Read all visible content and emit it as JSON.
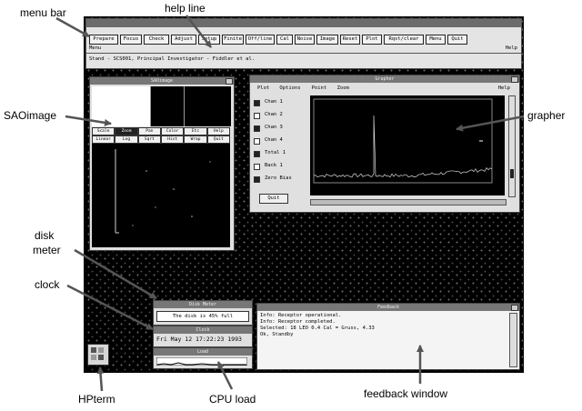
{
  "annotations": {
    "menu_bar": "menu bar",
    "help_line": "help line",
    "saoimage": "SAOimage",
    "grapher": "grapher",
    "disk_meter_line1": "disk",
    "disk_meter_line2": "meter",
    "clock": "clock",
    "hpterm": "HPterm",
    "cpu_load": "CPU load",
    "feedback_window": "feedback window"
  },
  "menu_buttons": [
    "Prepare",
    "Focus",
    "Check",
    "Adjust",
    "Setup",
    "Finite",
    "Off/line",
    "Cal",
    "Noise",
    "Image",
    "Reset",
    "Plot",
    "Rqst/clear",
    "Menu",
    "Quit"
  ],
  "help_label": "Help",
  "help_line_left": "Menu",
  "status_line": "Stand - SCS001, Principal Investigator - Fiddler et al.",
  "saoimage": {
    "title": "SAOimage",
    "buttons_row1": [
      "Scale",
      "Zoom",
      "Pan",
      "Color",
      "Etc",
      "Help"
    ],
    "buttons_row2": [
      "Linear",
      "Log",
      "Sqrt",
      "Hist",
      "Wrap",
      "Quit"
    ]
  },
  "grapher": {
    "title": "Grapher",
    "menu": [
      "Plot",
      "Options",
      "Point",
      "Zoom"
    ],
    "help": "Help",
    "legend": [
      "Chan 1",
      "Chan 2",
      "Chan 3",
      "Chan 4",
      "Total 1",
      "Back 1",
      "Zero Bias"
    ],
    "quit_button": "Quit"
  },
  "disk_meter": {
    "title": "Disk Meter",
    "text": "The disk is 45% full"
  },
  "clock": {
    "title": "Clock",
    "text": "Fri May 12 17:22:23 1993"
  },
  "cpu_load": {
    "title": "Load"
  },
  "feedback": {
    "title": "Feedback",
    "lines": [
      "Info: Receptor operational.",
      "Info: Receptor completed.",
      "Selected: 18 LEO 0.4 Cal = Gruss, 4.33",
      "Ok, Standby"
    ]
  },
  "colors": {
    "desktop": "#000000",
    "window_bg": "#e0e0e0",
    "titlebar": "#777777",
    "plot_bg": "#000000"
  }
}
